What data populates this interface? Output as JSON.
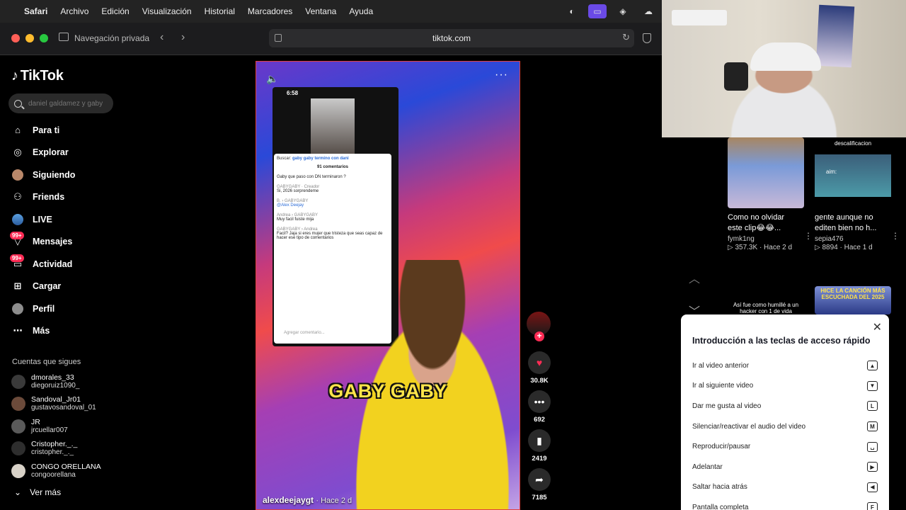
{
  "menubar": {
    "app": "Safari",
    "items": [
      "Archivo",
      "Edición",
      "Visualización",
      "Historial",
      "Marcadores",
      "Ventana",
      "Ayuda"
    ]
  },
  "browser": {
    "private_label": "Navegación privada",
    "url": "tiktok.com"
  },
  "tiktok": {
    "logo": "TikTok",
    "search_placeholder": "daniel galdamez y gaby",
    "nav": [
      {
        "label": "Para ti",
        "icon": "home-icon"
      },
      {
        "label": "Explorar",
        "icon": "compass-icon"
      },
      {
        "label": "Siguiendo",
        "icon": "following-avatar-icon"
      },
      {
        "label": "Friends",
        "icon": "friends-icon"
      },
      {
        "label": "LIVE",
        "icon": "live-icon"
      },
      {
        "label": "Mensajes",
        "icon": "messages-icon",
        "badge": "99+"
      },
      {
        "label": "Actividad",
        "icon": "activity-icon",
        "badge": "99+"
      },
      {
        "label": "Cargar",
        "icon": "upload-icon"
      },
      {
        "label": "Perfil",
        "icon": "profile-icon"
      },
      {
        "label": "Más",
        "icon": "more-dots-icon"
      }
    ],
    "following_title": "Cuentas que sigues",
    "following": [
      {
        "name": "dmorales_33",
        "user": "diegoruiz1090_"
      },
      {
        "name": "Sandoval_Jr01",
        "user": "gustavosandoval_01"
      },
      {
        "name": "JR",
        "user": "jrcuellar007"
      },
      {
        "name": "Cristopher._._",
        "user": "cristopher._._"
      },
      {
        "name": "CONGO ORELLANA",
        "user": "congoorellana"
      }
    ],
    "see_more": "Ver más"
  },
  "video": {
    "phone_time": "6:58",
    "comments_panel": {
      "search_prefix": "Buscar:",
      "search_query": "gaby gaby termino con dani",
      "count": "91 comentarios",
      "comments": [
        {
          "who": "",
          "text": "Gaby que paso con DN terminaron ?"
        },
        {
          "who": "GABYGABY · Creador",
          "text": "Si, 2026 sorprendeme"
        },
        {
          "who": "B. › GABYGABY",
          "text": "@Alex Deejay"
        },
        {
          "who": "Andrea › GABYGABY",
          "text": "Muy facil fuiste mija"
        },
        {
          "who": "GABYGABY › Andrea",
          "text": "Facil? Jaja si eres mujer que tristeza que seas capaz de hacer ese tipo de comentarios"
        }
      ],
      "add_comment": "Agregar comentario..."
    },
    "caption": "GABY GABY",
    "author": "alexdeejaygt",
    "time_ago": "· Hace 2 d"
  },
  "actions": {
    "likes": "30.8K",
    "comments": "692",
    "saves": "2419",
    "shares": "7185"
  },
  "recommended": [
    {
      "title": "Como no olvidar este clip😂😂...",
      "user": "fymk1ng",
      "stats": "▷ 357.3K · Hace 2 d"
    },
    {
      "title": "gente aunque no editen bien no h...",
      "user": "sepia476",
      "stats": "▷ 8894 · Hace 1 d",
      "thumb_text": "descalificacion",
      "thumb_sub": "aim:"
    }
  ],
  "recommended_row2": [
    {
      "thumb_text": "Así fue como humillé a un hacker con 1 de vida"
    },
    {
      "thumb_text": "HICE LA CANCIÓN MÁS ESCUCHADA DEL 2025"
    }
  ],
  "shortcuts": {
    "title": "Introducción a las teclas de acceso rápido",
    "rows": [
      {
        "label": "Ir al video anterior",
        "key": "▲"
      },
      {
        "label": "Ir al siguiente video",
        "key": "▼"
      },
      {
        "label": "Dar me gusta al video",
        "key": "L"
      },
      {
        "label": "Silenciar/reactivar el audio del video",
        "key": "M"
      },
      {
        "label": "Reproducir/pausar",
        "key": "␣"
      },
      {
        "label": "Adelantar",
        "key": "▶"
      },
      {
        "label": "Saltar hacia atrás",
        "key": "◀"
      },
      {
        "label": "Pantalla completa",
        "key": "F"
      }
    ]
  },
  "colors": {
    "tiktok_red": "#fe2c55",
    "background": "#000000",
    "menubar": "#232323",
    "toolbar": "#1c1c1e"
  }
}
